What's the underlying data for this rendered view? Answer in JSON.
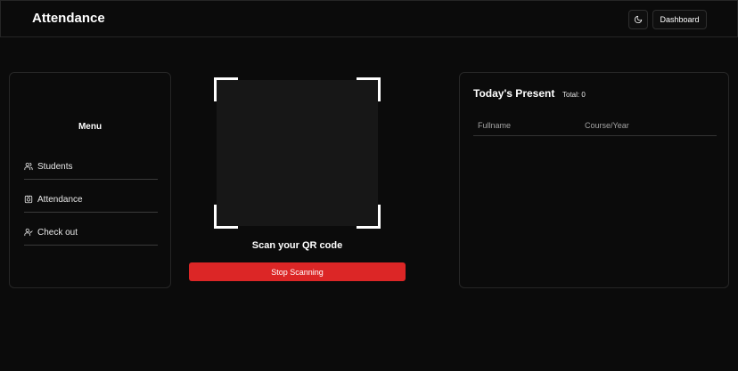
{
  "header": {
    "title": "Attendance",
    "theme_icon": "moon-icon",
    "dashboard_label": "Dashboard"
  },
  "menu": {
    "title": "Menu",
    "items": [
      {
        "label": "Students",
        "icon": "users-icon"
      },
      {
        "label": "Attendance",
        "icon": "camera-icon"
      },
      {
        "label": "Check out",
        "icon": "user-check-icon"
      }
    ]
  },
  "scanner": {
    "label": "Scan your QR code",
    "stop_label": "Stop Scanning"
  },
  "present": {
    "title": "Today's Present",
    "total": "Total: 0",
    "columns": [
      "Fullname",
      "Course/Year"
    ]
  },
  "colors": {
    "background": "#0b0b0b",
    "accent_red": "#dc2626",
    "border": "#262626"
  }
}
